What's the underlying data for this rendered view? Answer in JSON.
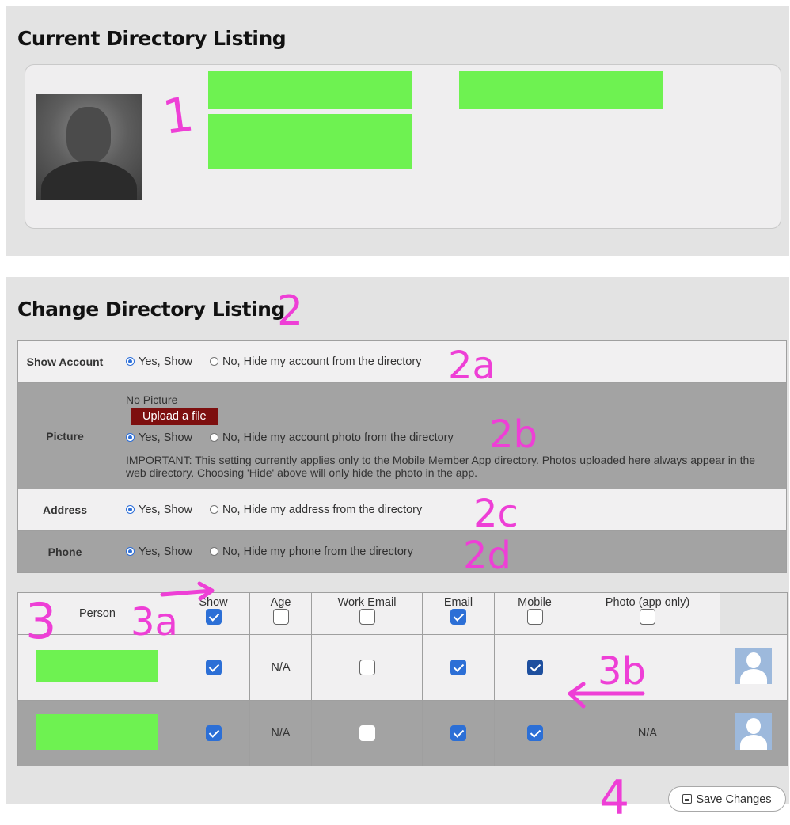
{
  "current": {
    "title": "Current Directory Listing"
  },
  "change": {
    "title": "Change Directory Listing",
    "rows": {
      "show_account": {
        "label": "Show Account",
        "yes": "Yes, Show",
        "no": "No, Hide my account from the directory"
      },
      "picture": {
        "label": "Picture",
        "status": "No Picture",
        "upload": "Upload a file",
        "yes": "Yes, Show",
        "no": "No, Hide my account photo from the directory",
        "note": "IMPORTANT: This setting currently applies only to the Mobile Member App directory. Photos uploaded here always appear in the web directory. Choosing 'Hide' above will only hide the photo in the app."
      },
      "address": {
        "label": "Address",
        "yes": "Yes, Show",
        "no": "No, Hide my address from the directory"
      },
      "phone": {
        "label": "Phone",
        "yes": "Yes, Show",
        "no": "No, Hide my phone from the directory"
      }
    }
  },
  "people": {
    "headers": {
      "person": "Person",
      "show": "Show",
      "age": "Age",
      "work_email": "Work Email",
      "email": "Email",
      "mobile": "Mobile",
      "photo": "Photo (app only)"
    },
    "rows": [
      {
        "age": "N/A",
        "photo": ""
      },
      {
        "age": "N/A",
        "photo": "N/A"
      }
    ]
  },
  "save_label": "Save Changes",
  "annotations": [
    "1",
    "2",
    "2a",
    "2b",
    "2c",
    "2d",
    "3",
    "3a",
    "3b",
    "4"
  ],
  "colors": {
    "redaction": "#6ef251",
    "annotation": "#ee3fd6",
    "upload_button": "#7d0f0f",
    "checkbox": "#2c6fd6"
  }
}
